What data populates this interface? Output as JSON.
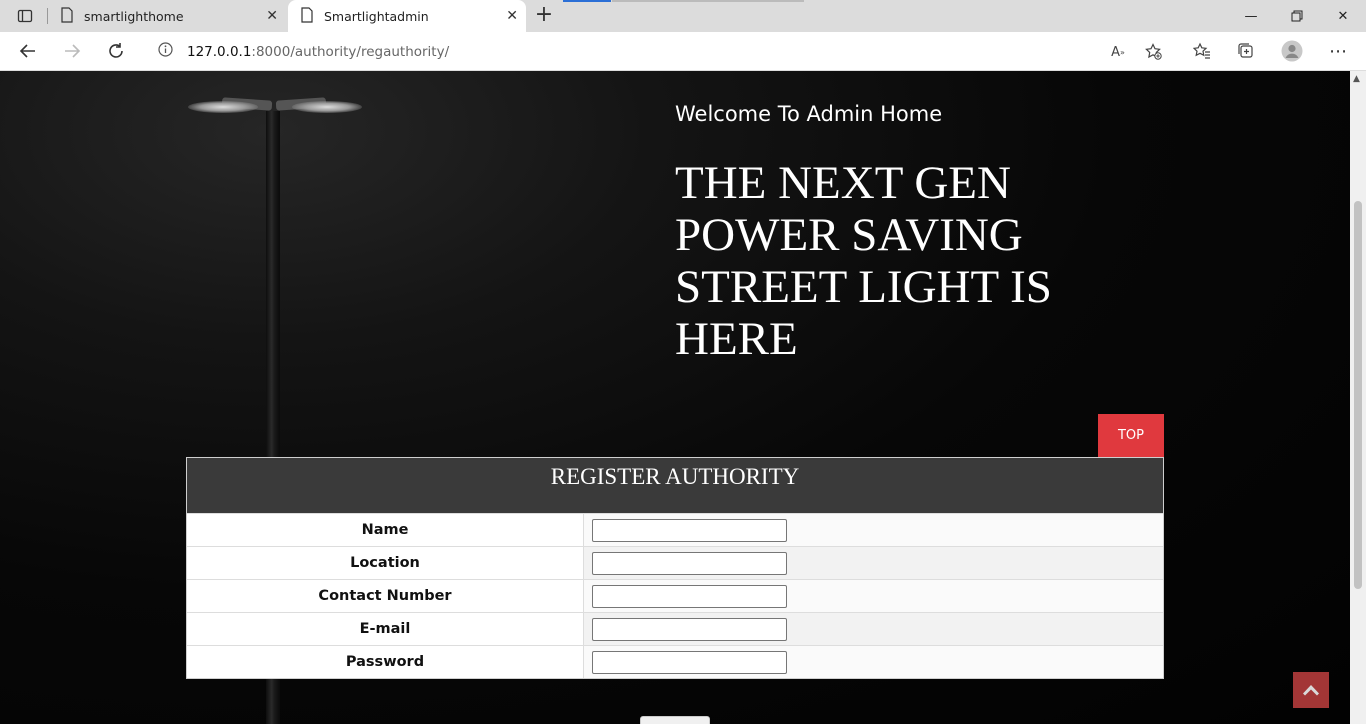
{
  "browser": {
    "tabs": [
      {
        "title": "smartlighthome",
        "active": false
      },
      {
        "title": "Smartlightadmin",
        "active": true
      }
    ],
    "url_host": "127.0.0.1",
    "url_path": ":8000/authority/regauthority/"
  },
  "page": {
    "welcome": "Welcome To Admin Home",
    "hero": "THE NEXT GEN POWER SAVING STREET LIGHT IS HERE",
    "top_button": "TOP",
    "form": {
      "title": "REGISTER AUTHORITY",
      "fields": [
        {
          "label": "Name",
          "value": ""
        },
        {
          "label": "Location",
          "value": ""
        },
        {
          "label": "Contact Number",
          "value": ""
        },
        {
          "label": "E-mail",
          "value": ""
        },
        {
          "label": "Password",
          "value": ""
        }
      ]
    }
  },
  "colors": {
    "top_button": "#e0393e",
    "form_header": "#3a3a3a",
    "scroll_top_button": "#c0403f"
  }
}
